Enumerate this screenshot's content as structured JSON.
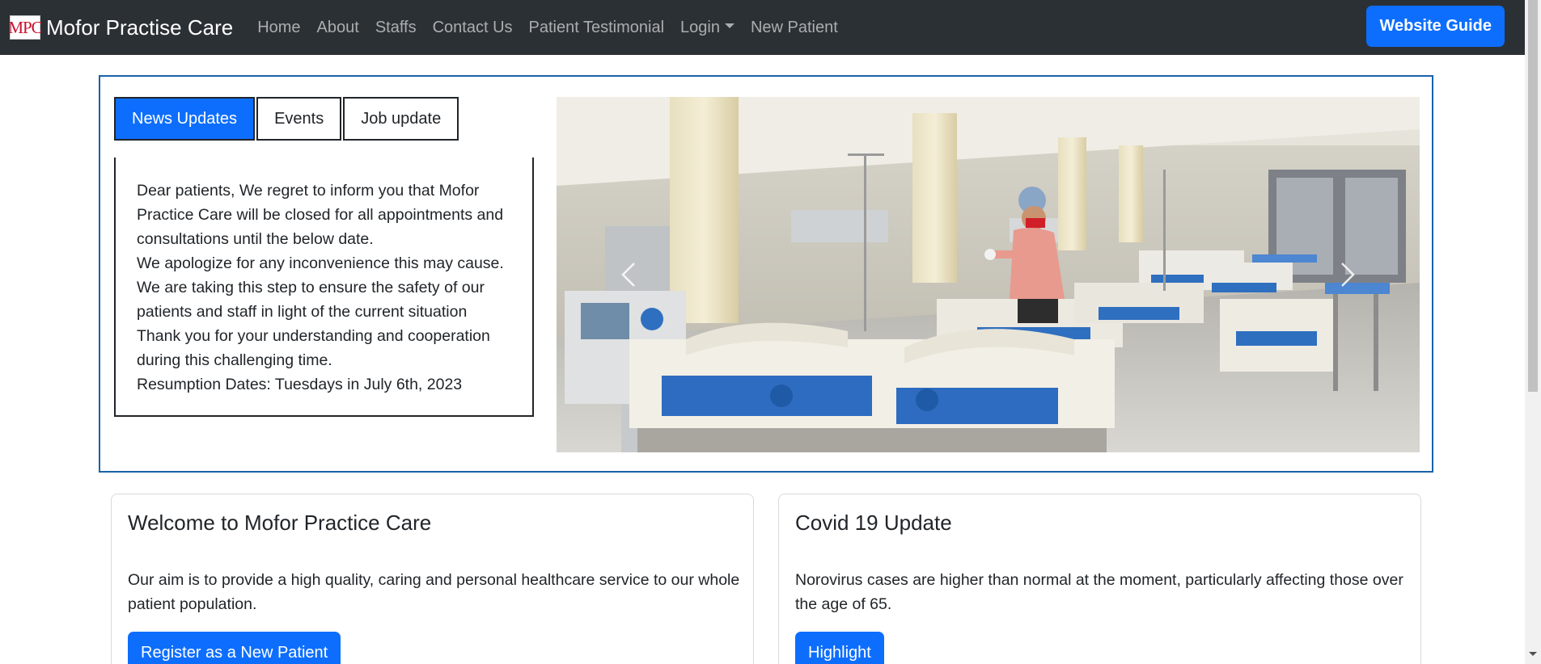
{
  "navbar": {
    "logo_text": "MPC",
    "brand_name": "Mofor Practise Care",
    "links": [
      "Home",
      "About",
      "Staffs",
      "Contact Us",
      "Patient Testimonial",
      "Login",
      "New Patient"
    ],
    "guide_button": "Website Guide"
  },
  "news": {
    "tabs": [
      "News Updates",
      "Events",
      "Job update"
    ],
    "active_tab": "News Updates",
    "lines": [
      "Dear patients, We regret to inform you that Mofor",
      "Practice Care will be closed for all appointments and",
      "consultations until the below date.",
      "We apologize for any inconvenience this may cause.",
      "We are taking this step to ensure the safety of our",
      "patients and staff in light of the current situation",
      "Thank you for your understanding and cooperation",
      "during this challenging time.",
      "Resumption Dates: Tuesdays in July 6th, 2023"
    ]
  },
  "carousel": {
    "image": "hospital-ward-photo",
    "prev_icon": "chevron-left-icon",
    "next_icon": "chevron-right-icon"
  },
  "cards": [
    {
      "title": "Welcome to Mofor Practice Care",
      "text": "Our aim is to provide a high quality, caring and personal healthcare service to our whole patient population.",
      "button": "Register as a New Patient"
    },
    {
      "title": "Covid 19 Update",
      "text": "Norovirus cases are higher than normal at the moment, particularly affecting those over the age of 65.",
      "button": "Highlight"
    }
  ],
  "colors": {
    "navbar_bg": "#2b3035",
    "primary": "#0d6efd",
    "frame_border": "#1a62a8",
    "logo_red": "#c8102e"
  }
}
